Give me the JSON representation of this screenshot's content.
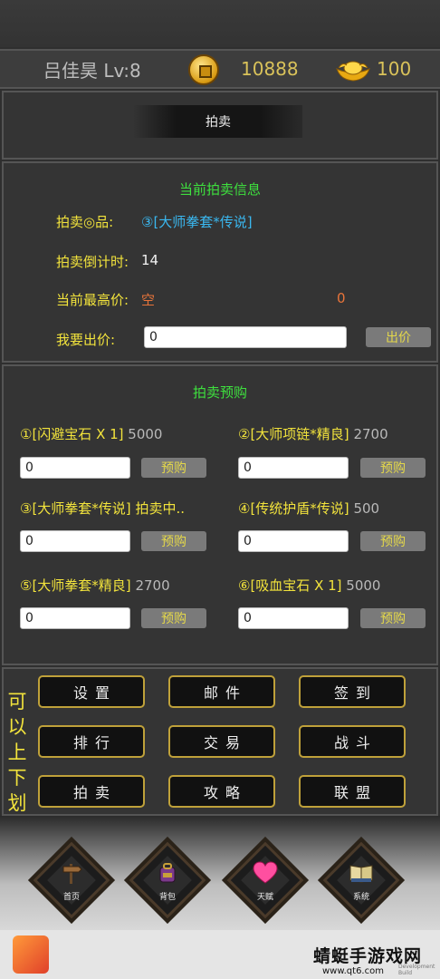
{
  "header": {
    "player_name": "吕佳昊 Lv:8",
    "coins": "10888",
    "ingots": "100",
    "coin_icon": "copper-coin-icon",
    "ingot_icon": "gold-ingot-icon"
  },
  "title": {
    "tab_label": "拍卖"
  },
  "current_auction": {
    "section_title": "当前拍卖信息",
    "item_label": "拍卖◎品:",
    "item_value": "③[大师拳套*传说]",
    "countdown_label": "拍卖倒计时:",
    "countdown_value": "14",
    "highest_label": "当前最高价:",
    "highest_bidder": "空",
    "highest_price": "0",
    "bid_label": "我要出价:",
    "bid_value": "0",
    "bid_button": "出价"
  },
  "preorder": {
    "section_title": "拍卖预购",
    "button_label": "预购",
    "items": [
      {
        "name": "①[闪避宝石 X 1]",
        "price": "5000",
        "input": "0"
      },
      {
        "name": "②[大师项链*精良]",
        "price": "2700",
        "input": "0"
      },
      {
        "name": "③[大师拳套*传说]",
        "price": "拍卖中..",
        "input": "0"
      },
      {
        "name": "④[传统护盾*传说]",
        "price": "500",
        "input": "0"
      },
      {
        "name": "⑤[大师拳套*精良]",
        "price": "2700",
        "input": "0"
      },
      {
        "name": "⑥[吸血宝石 X 1]",
        "price": "5000",
        "input": "0"
      }
    ]
  },
  "menu": {
    "scroll_hint": "可以上下划",
    "buttons": [
      "设置",
      "邮件",
      "签到",
      "排行",
      "交易",
      "战斗",
      "拍卖",
      "攻略",
      "联盟"
    ]
  },
  "bottom_nav": [
    {
      "label": "首页",
      "icon": "signpost-icon"
    },
    {
      "label": "背包",
      "icon": "backpack-icon"
    },
    {
      "label": "天赋",
      "icon": "heart-icon"
    },
    {
      "label": "系统",
      "icon": "book-icon"
    }
  ],
  "watermark": {
    "text": "蜻蜓手游戏网",
    "url": "www.qt6.com",
    "tiny": "Development Build"
  },
  "colors": {
    "accent_green": "#3ee03e",
    "label_yellow": "#f2e33c",
    "link_blue": "#3ab8f0",
    "warn_orange": "#e8743a",
    "gold": "#d9c25a"
  }
}
